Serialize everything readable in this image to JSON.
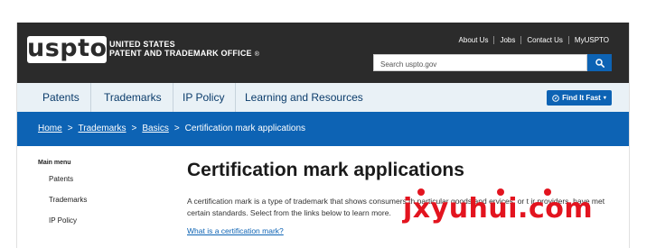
{
  "header": {
    "logo": "uspto",
    "agency_line1": "UNITED STATES",
    "agency_line2": "PATENT AND TRADEMARK OFFICE",
    "registered": "®",
    "links": [
      "About Us",
      "Jobs",
      "Contact Us",
      "MyUSPTO"
    ],
    "search_placeholder": "Search uspto.gov",
    "search_icon": "search-icon"
  },
  "nav": {
    "items": [
      "Patents",
      "Trademarks",
      "IP Policy",
      "Learning and Resources"
    ],
    "find_it_fast": "Find It Fast",
    "find_it_fast_icon": "compass-icon"
  },
  "breadcrumb": {
    "items": [
      "Home",
      "Trademarks",
      "Basics"
    ],
    "current": "Certification mark applications",
    "separator": ">"
  },
  "sidebar": {
    "title": "Main menu",
    "items": [
      "Patents",
      "Trademarks",
      "IP Policy"
    ]
  },
  "main": {
    "title": "Certification mark applications",
    "intro_a": "A certification mark is a type of trademark that shows consumers th",
    "intro_b": "particular goods and",
    "intro_c": "ervices, or t",
    "intro_d": "ir providers, have met certain standards. Select from the links below to learn more.",
    "question_link": "What is a certification mark?"
  },
  "watermark": "jxyuhui.com",
  "colors": {
    "header_bg": "#2b2b2b",
    "primary_blue": "#0d63b4",
    "nav_bg": "#e9f1f6",
    "watermark_red": "#e3141f"
  }
}
